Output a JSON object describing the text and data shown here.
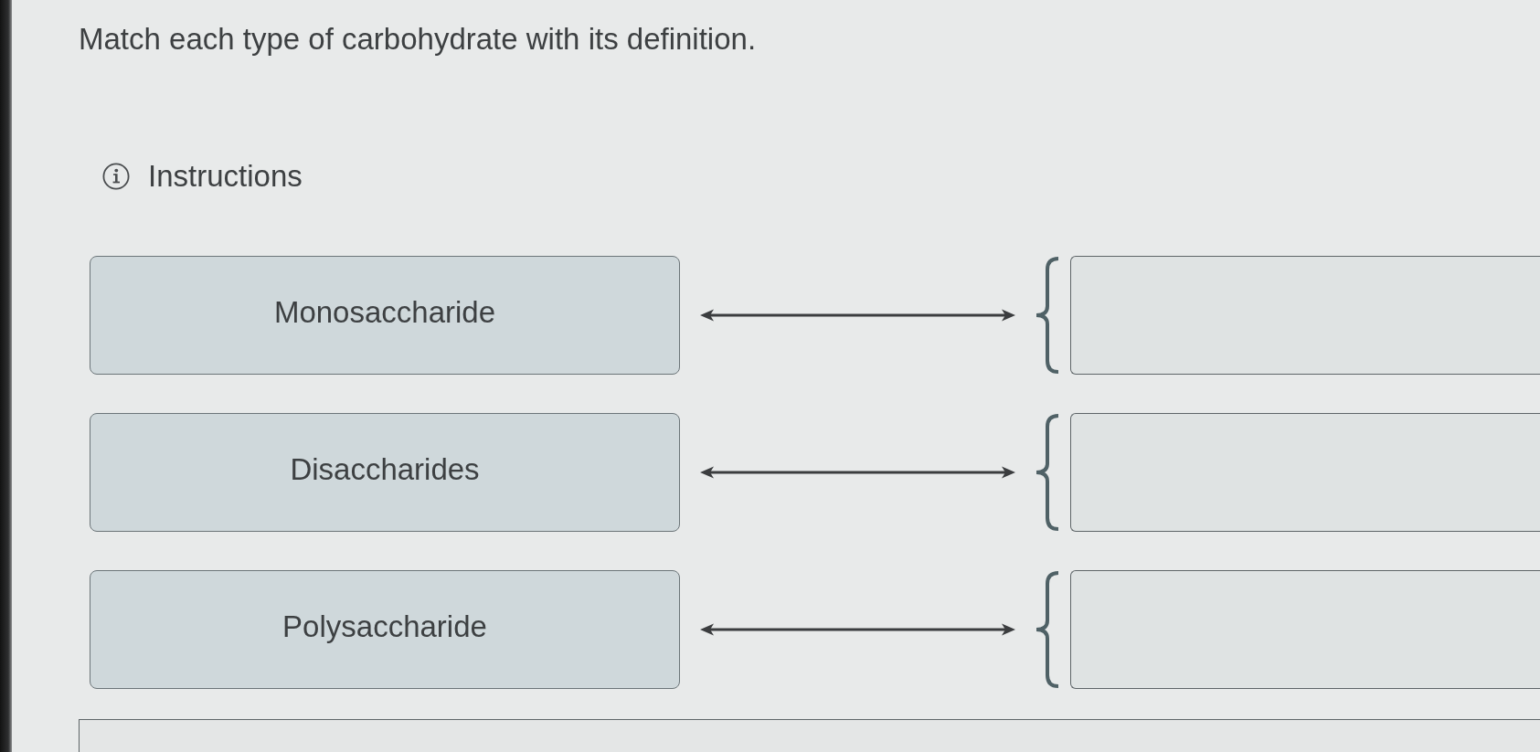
{
  "question": {
    "prompt": "Match each type of carbohydrate with its definition."
  },
  "instructions": {
    "label": "Instructions"
  },
  "pairs": [
    {
      "term": "Monosaccharide"
    },
    {
      "term": "Disaccharides"
    },
    {
      "term": "Polysaccharide"
    }
  ]
}
